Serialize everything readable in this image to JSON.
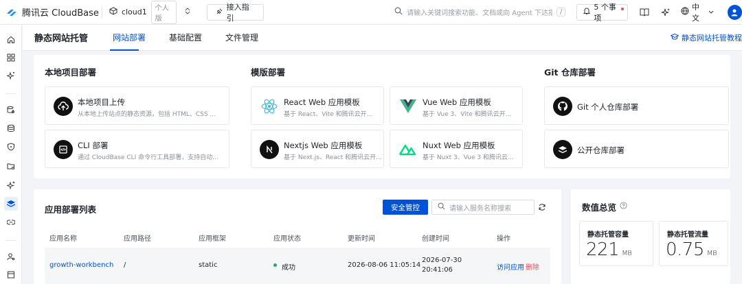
{
  "topbar": {
    "brand": "腾讯云 CloudBase",
    "env_name": "cloud1",
    "env_tag": "个人版",
    "guide_button": "接入指引",
    "search_placeholder": "请输入关键词搜索功能、文档或向 Agent 下达指令",
    "search_shortcut": "/",
    "notifications": "5 个事项",
    "language": "中文"
  },
  "subnav": {
    "page_title": "静态网站托管",
    "tabs": [
      "网站部署",
      "基础配置",
      "文件管理"
    ],
    "tutorial": "静态网站托管教程"
  },
  "deploy": {
    "local": {
      "title": "本地项目部署",
      "cards": [
        {
          "title": "本地项目上传",
          "desc": "从本地上传站点的静态资源，包括 HTML、CSS ..."
        },
        {
          "title": "CLI 部署",
          "desc": "通过 CloudBase CLI 命令行工具部署，支持自动..."
        }
      ]
    },
    "template": {
      "title": "模版部署",
      "cards": [
        {
          "title": "React Web 应用模板",
          "desc": "基于 React、Vite 和腾讯云开..."
        },
        {
          "title": "Vue Web 应用模板",
          "desc": "基于 Vue 3、Vite 和腾讯云开..."
        },
        {
          "title": "Nextjs Web 应用模板",
          "desc": "基于 Next.js、React 和腾讯云开..."
        },
        {
          "title": "Nuxt Web 应用模板",
          "desc": "基于 Nuxt 3、Vue 3 和腾讯云..."
        }
      ]
    },
    "git": {
      "title": "Git 仓库部署",
      "cards": [
        {
          "title": "Git 个人仓库部署"
        },
        {
          "title": "公开仓库部署"
        }
      ]
    }
  },
  "apps": {
    "title": "应用部署列表",
    "security_button": "安全管控",
    "search_placeholder": "请输入服务名称搜索",
    "columns": [
      "应用名称",
      "应用路径",
      "应用框架",
      "应用状态",
      "更新时间",
      "创建时间",
      "操作"
    ],
    "rows": [
      {
        "name": "growth-workbench",
        "path": "/",
        "framework": "static",
        "status": "成功",
        "updated": "2026-08-06 11:05:14",
        "created_date": "2026-07-30",
        "created_time": "20:41:06",
        "action_visit": "访问应用",
        "action_delete": "删除"
      }
    ]
  },
  "stats": {
    "title": "数值总览",
    "items": [
      {
        "label": "静态托管容量",
        "value": "221",
        "unit": "MB"
      },
      {
        "label": "静态托管流量",
        "value": "0.75",
        "unit": "MB"
      }
    ]
  },
  "colors": {
    "primary": "#0052d9",
    "success": "#2ba471",
    "danger": "#e34d59"
  }
}
